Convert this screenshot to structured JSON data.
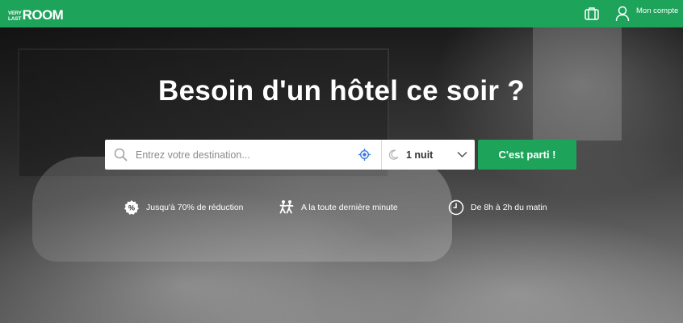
{
  "brand": {
    "logo_line1": "VERY",
    "logo_line2": "LAST",
    "logo_main": "ROOM",
    "color": "#1ea35a"
  },
  "header": {
    "account_label": "Mon compte",
    "icons": [
      "suitcase-icon",
      "user-icon"
    ]
  },
  "hero": {
    "title": "Besoin d'un hôtel ce soir ?"
  },
  "search": {
    "placeholder": "Entrez votre destination...",
    "value": "",
    "icons": [
      "search-icon",
      "locate-icon"
    ]
  },
  "nights": {
    "selected": "1 nuit",
    "icons": [
      "moon-icon",
      "chevron-down-icon"
    ]
  },
  "cta": {
    "label": "C'est parti !"
  },
  "features": [
    {
      "icon": "percent-badge-icon",
      "label": "Jusqu'à 70% de réduction"
    },
    {
      "icon": "running-people-icon",
      "label": "A la toute dernière minute"
    },
    {
      "icon": "clock-icon",
      "label": "De 8h à 2h du matin"
    }
  ]
}
